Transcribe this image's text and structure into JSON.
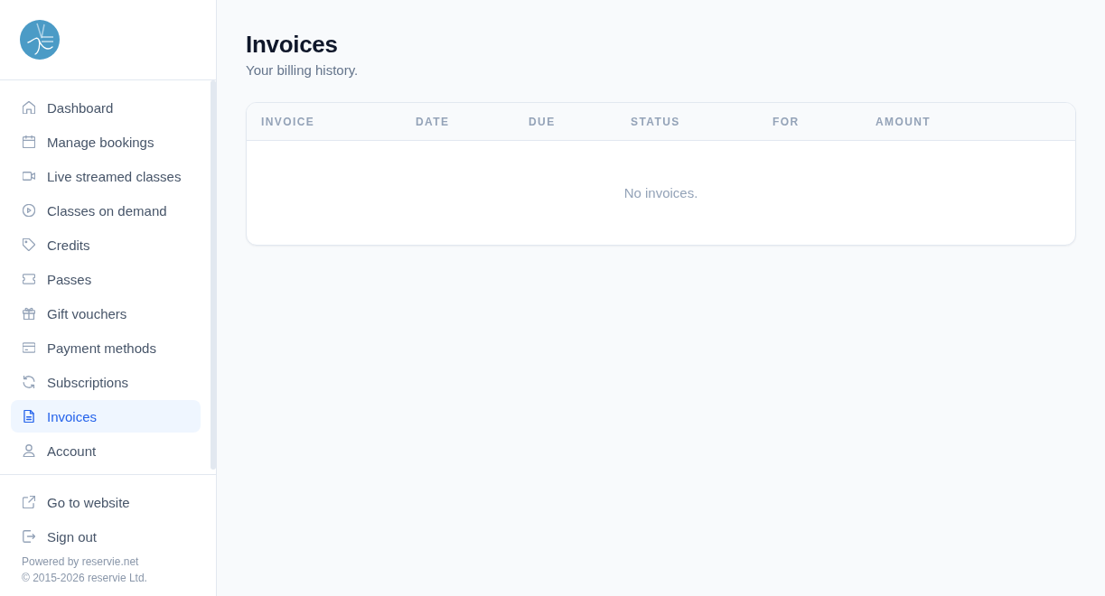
{
  "sidebar": {
    "nav_items": [
      {
        "label": "Dashboard",
        "selected": false
      },
      {
        "label": "Manage bookings",
        "selected": false
      },
      {
        "label": "Live streamed classes",
        "selected": false
      },
      {
        "label": "Classes on demand",
        "selected": false
      },
      {
        "label": "Credits",
        "selected": false
      },
      {
        "label": "Passes",
        "selected": false
      },
      {
        "label": "Gift vouchers",
        "selected": false
      },
      {
        "label": "Payment methods",
        "selected": false
      },
      {
        "label": "Subscriptions",
        "selected": false
      },
      {
        "label": "Invoices",
        "selected": true
      },
      {
        "label": "Account",
        "selected": false
      }
    ],
    "footer_links": [
      {
        "label": "Go to website"
      },
      {
        "label": "Sign out"
      }
    ],
    "powered_by": "Powered by reservie.net",
    "copyright": "© 2015-2026 reservie Ltd."
  },
  "page": {
    "title": "Invoices",
    "subtitle": "Your billing history."
  },
  "table": {
    "columns": [
      "INVOICE",
      "DATE",
      "DUE",
      "STATUS",
      "FOR",
      "AMOUNT"
    ],
    "empty_message": "No invoices."
  }
}
